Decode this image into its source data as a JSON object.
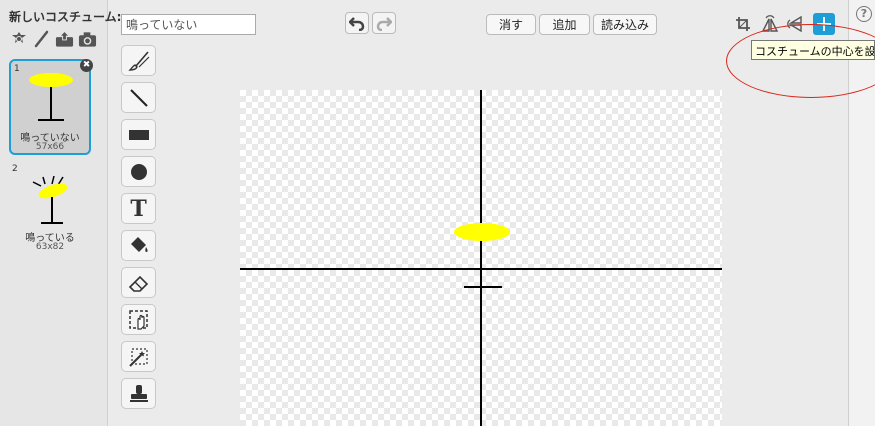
{
  "left_panel": {
    "new_costume_label": "新しいコスチューム:",
    "new_tools": [
      {
        "icon": "sprite-library-icon"
      },
      {
        "icon": "paint-brush-icon"
      },
      {
        "icon": "upload-icon"
      },
      {
        "icon": "camera-icon"
      }
    ],
    "costumes": [
      {
        "number": "1",
        "name": "鳴っていない",
        "size": "57x66",
        "selected": true
      },
      {
        "number": "2",
        "name": "鳴っている",
        "size": "63x82",
        "selected": false
      }
    ],
    "delete_icon": "✖"
  },
  "editor": {
    "costume_name_value": "鳴っていない",
    "undo_icon": "undo-icon",
    "redo_icon": "redo-icon",
    "buttons": {
      "clear": "消す",
      "add": "追加",
      "import": "読み込み"
    },
    "tools": [
      "brush-tool-icon",
      "line-tool-icon",
      "rectangle-tool-icon",
      "ellipse-tool-icon",
      "text-tool-icon",
      "fill-tool-icon",
      "eraser-tool-icon",
      "select-tool-icon",
      "wand-tool-icon",
      "stamp-tool-icon"
    ],
    "text_tool_glyph": "T",
    "right_tools": [
      "crop-icon",
      "flip-horizontal-icon",
      "flip-vertical-icon",
      "set-center-icon"
    ],
    "tooltip": "コスチュームの中心を設定",
    "help_icon": "?"
  },
  "colors": {
    "accent": "#1e9ed6",
    "costume_fill": "#ffff00",
    "annotation": "#d9261c"
  }
}
